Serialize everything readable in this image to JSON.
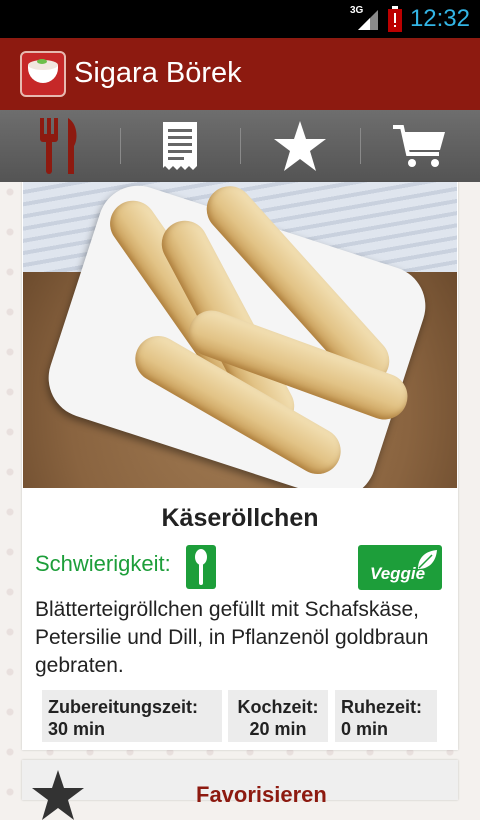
{
  "status_bar": {
    "network": "3G",
    "time": "12:32"
  },
  "app": {
    "title": "Sigara Börek"
  },
  "tabs": [
    {
      "icon": "fork-knife-icon"
    },
    {
      "icon": "receipt-icon"
    },
    {
      "icon": "star-icon"
    },
    {
      "icon": "cart-icon"
    }
  ],
  "recipe": {
    "name": "Käseröllchen",
    "difficulty_label": "Schwierigkeit:",
    "difficulty_level": 1,
    "badge": "Veggie",
    "description": "Blätterteigröllchen gefüllt mit Schafskäse, Petersilie und Dill, in Pflanzenöl goldbraun gebraten.",
    "times": [
      {
        "label": "Zubereitungszeit:",
        "value": "30 min"
      },
      {
        "label": "Kochzeit:",
        "value": "20 min"
      },
      {
        "label": "Ruhezeit:",
        "value": "0 min"
      }
    ]
  },
  "favorite": {
    "label": "Favorisieren"
  },
  "colors": {
    "brand": "#8d1a10",
    "accent_green": "#1d9e3a",
    "status_time": "#33b5e5"
  }
}
